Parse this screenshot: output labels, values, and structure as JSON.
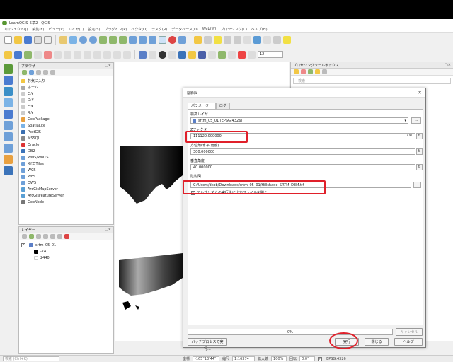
{
  "window": {
    "title": "LearnQGIS_5章2 - QGIS"
  },
  "menubar": [
    "プロジェクト(J)",
    "編集(E)",
    "ビュー(V)",
    "レイヤ(L)",
    "設定(S)",
    "プラグイン(P)",
    "ベクタ(O)",
    "ラスタ(R)",
    "データベース(D)",
    "Web(W)",
    "プロセシング(C)",
    "ヘルプ(H)"
  ],
  "scale_combo": "12",
  "browser": {
    "title": "ブラウザ",
    "items": [
      "お気に入り",
      "ホーム",
      "C:¥",
      "D:¥",
      "E:¥",
      "R:¥",
      "GeoPackage",
      "SpatiaLite",
      "PostGIS",
      "MSSQL",
      "Oracle",
      "DB2",
      "WMS/WMTS",
      "XYZ Tiles",
      "WCS",
      "WFS",
      "OWS",
      "ArcGisMapServer",
      "ArcGisFeatureServer",
      "GeoNode"
    ]
  },
  "layers": {
    "title": "レイヤー",
    "layer_name": "srtm_05_01",
    "legend_min": "-74",
    "legend_max": "2440"
  },
  "processing": {
    "title": "プロセシングツールボックス",
    "search_placeholder": "検索"
  },
  "dialog": {
    "title": "陰影図",
    "tabs": [
      "パラメーター",
      "ログ"
    ],
    "input_layer_label": "標高レイヤ",
    "input_layer_value": "srtm_05_01 [EPSG:4326]",
    "zfactor_label": "Zファクタ",
    "zfactor_value": "111120.000000",
    "azimuth_label": "方位角(水平 角度)",
    "azimuth_value": "300.000000",
    "vertical_label": "垂直角度",
    "vertical_value": "40.000000",
    "output_label": "陰影図",
    "output_value": "C:/Users/dkob/Downloads/srtm_05_01/Hillshade_SRTM_DEM.tif",
    "open_output_label": "アルゴリズムの実行後に出力ファイルを開く",
    "progress": "0%",
    "cancel": "キャンセル",
    "batch": "バッチプロセスで実行...",
    "run": "実行",
    "close": "閉じる",
    "help": "ヘルプ",
    "ellipsis": "...",
    "dropdown_arrow": "▾",
    "spin_up_down": "⇅"
  },
  "statusbar": {
    "search_placeholder": "検索 (Ctrl+K)",
    "coord_label": "座標",
    "coord_value": "-165°13'44\"",
    "scale_label": "縮尺",
    "scale_value": "1:16374",
    "magnify_label": "拡大鏡",
    "magnify_value": "100%",
    "rotation_label": "回転",
    "rotation_value": "0.0°",
    "crs": "EPSG:4326"
  }
}
